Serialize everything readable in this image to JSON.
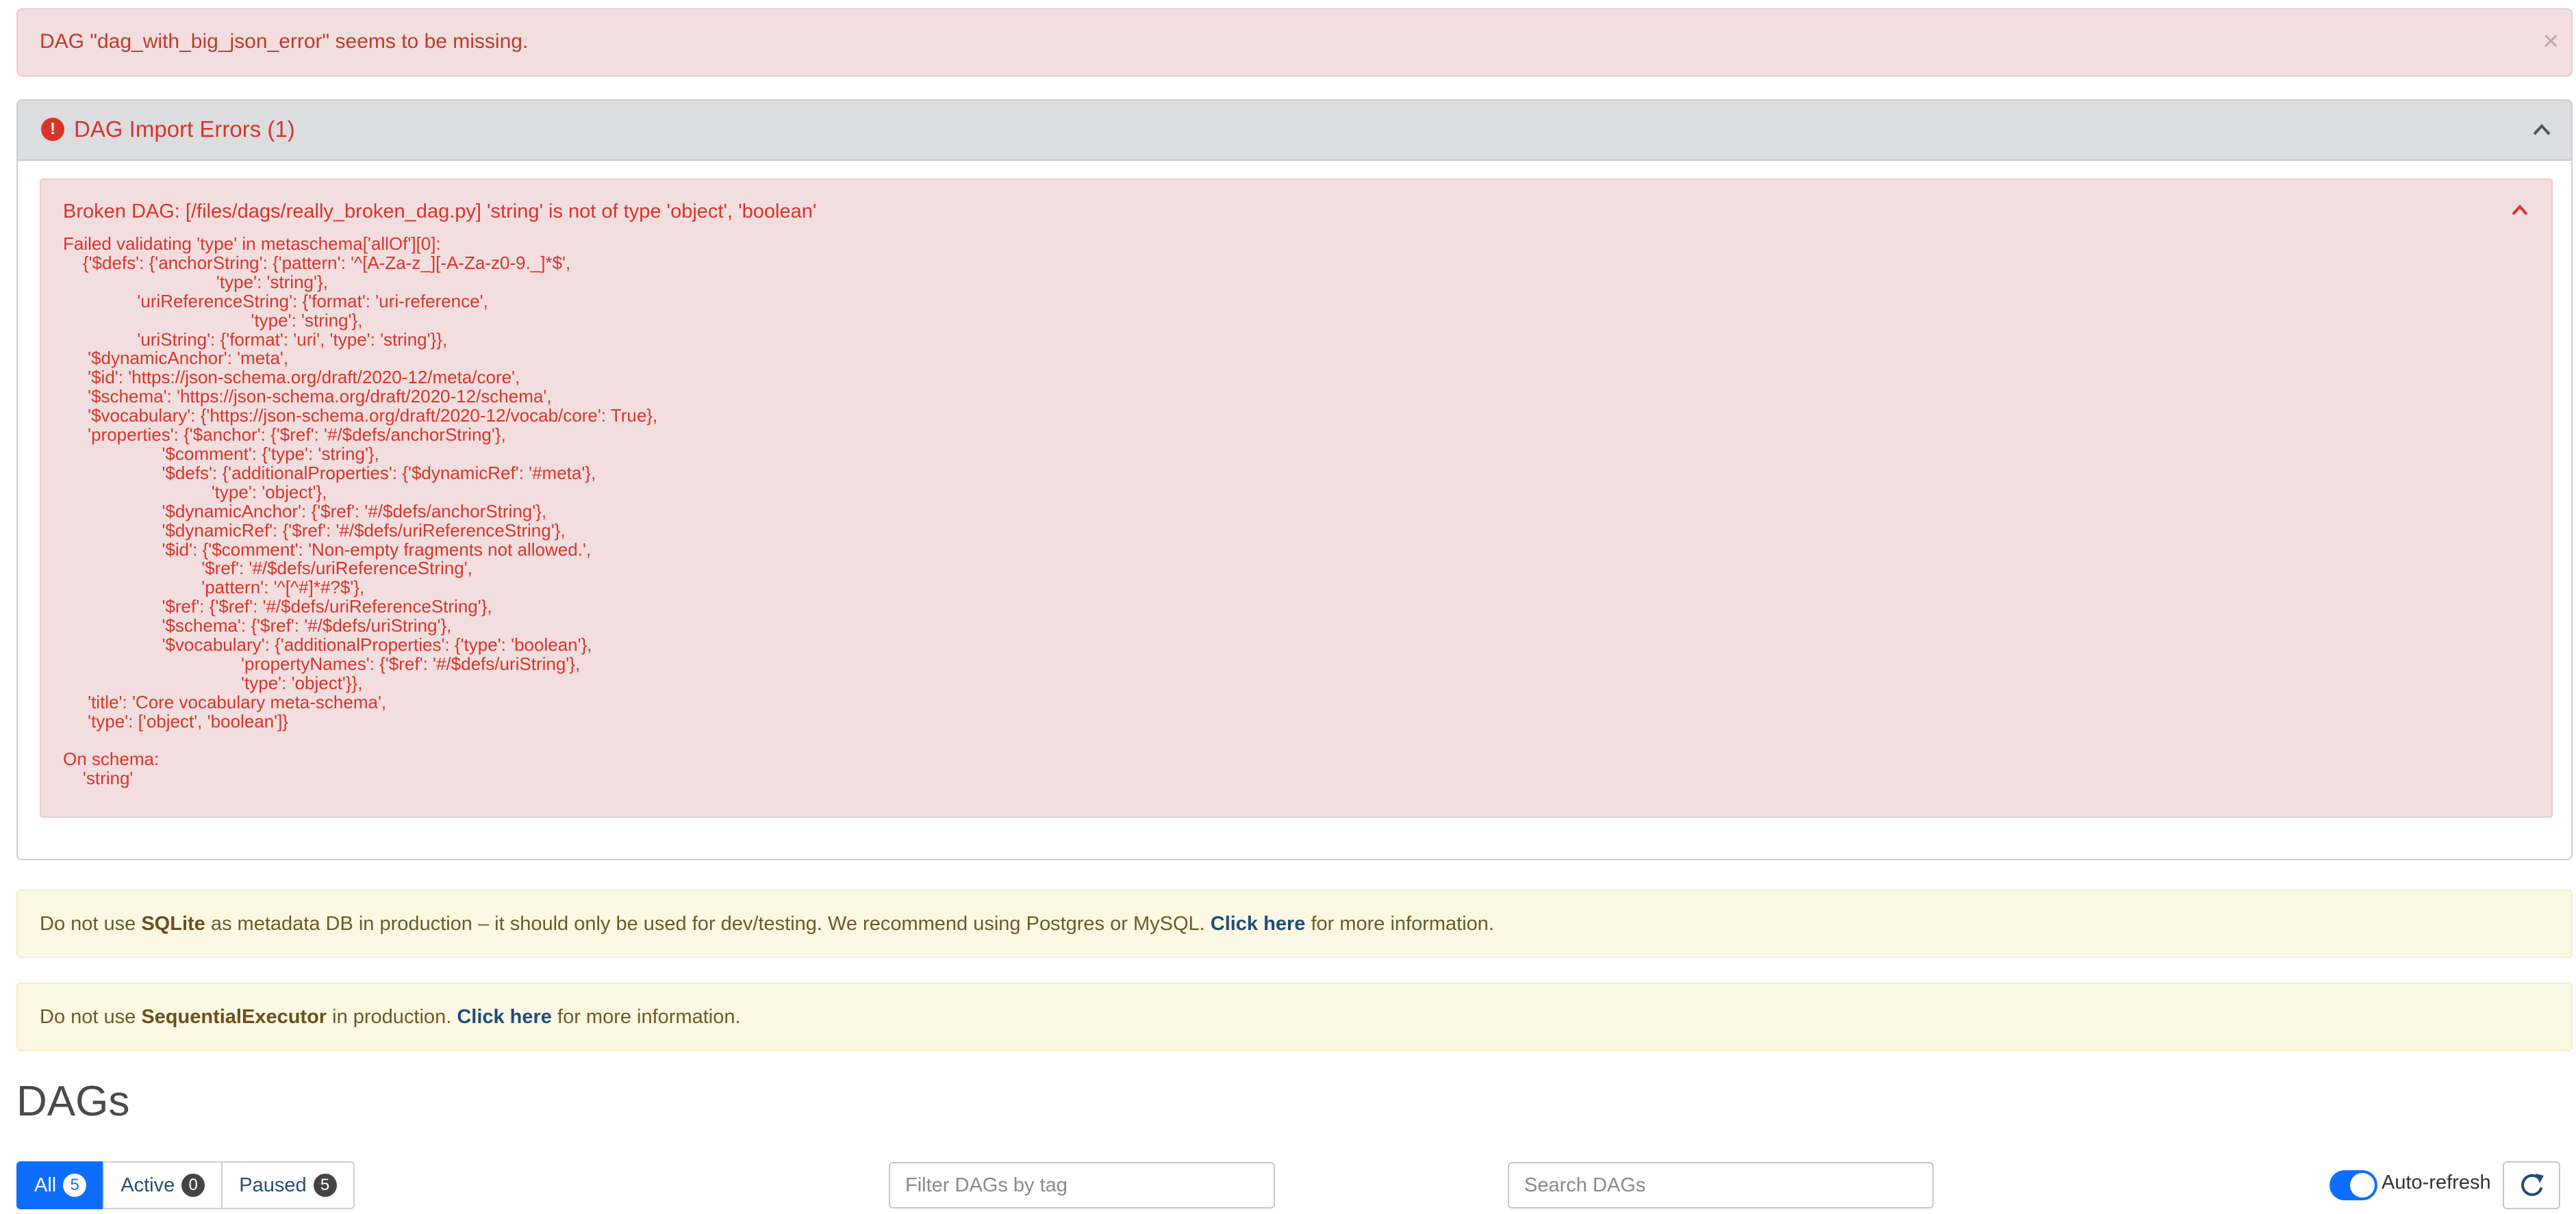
{
  "missing_alert": {
    "message": "DAG \"dag_with_big_json_error\" seems to be missing.",
    "close_glyph": "×"
  },
  "import_errors": {
    "title": "DAG Import Errors (1)",
    "icon_glyph": "!",
    "error": {
      "header": "Broken DAG: [/files/dags/really_broken_dag.py] 'string' is not of type 'object', 'boolean'",
      "details": "Failed validating 'type' in metaschema['allOf'][0]:\n    {'$defs': {'anchorString': {'pattern': '^[A-Za-z_][-A-Za-z0-9._]*$',\n                               'type': 'string'},\n               'uriReferenceString': {'format': 'uri-reference',\n                                      'type': 'string'},\n               'uriString': {'format': 'uri', 'type': 'string'}},\n     '$dynamicAnchor': 'meta',\n     '$id': 'https://json-schema.org/draft/2020-12/meta/core',\n     '$schema': 'https://json-schema.org/draft/2020-12/schema',\n     '$vocabulary': {'https://json-schema.org/draft/2020-12/vocab/core': True},\n     'properties': {'$anchor': {'$ref': '#/$defs/anchorString'},\n                    '$comment': {'type': 'string'},\n                    '$defs': {'additionalProperties': {'$dynamicRef': '#meta'},\n                              'type': 'object'},\n                    '$dynamicAnchor': {'$ref': '#/$defs/anchorString'},\n                    '$dynamicRef': {'$ref': '#/$defs/uriReferenceString'},\n                    '$id': {'$comment': 'Non-empty fragments not allowed.',\n                            '$ref': '#/$defs/uriReferenceString',\n                            'pattern': '^[^#]*#?$'},\n                    '$ref': {'$ref': '#/$defs/uriReferenceString'},\n                    '$schema': {'$ref': '#/$defs/uriString'},\n                    '$vocabulary': {'additionalProperties': {'type': 'boolean'},\n                                    'propertyNames': {'$ref': '#/$defs/uriString'},\n                                    'type': 'object'}},\n     'title': 'Core vocabulary meta-schema',\n     'type': ['object', 'boolean']}\n\nOn schema:\n    'string'"
    }
  },
  "warnings": {
    "sqlite": {
      "prefix": "Do not use ",
      "bold": "SQLite",
      "middle": " as metadata DB in production – it should only be used for dev/testing. We recommend using Postgres or MySQL. ",
      "link": "Click here",
      "suffix": " for more information."
    },
    "executor": {
      "prefix": "Do not use ",
      "bold": "SequentialExecutor",
      "middle": " in production. ",
      "link": "Click here",
      "suffix": " for more information."
    }
  },
  "dags": {
    "title": "DAGs",
    "filters": [
      {
        "label": "All",
        "count": "5"
      },
      {
        "label": "Active",
        "count": "0"
      },
      {
        "label": "Paused",
        "count": "5"
      }
    ],
    "tag_placeholder": "Filter DAGs by tag",
    "search_placeholder": "Search DAGs",
    "auto_refresh_label": "Auto-refresh"
  },
  "icons": {
    "close": "close-icon",
    "error": "error-circle-icon",
    "collapse": "chevron-up-icon",
    "refresh": "refresh-icon"
  },
  "colors": {
    "danger": "#d9342b",
    "primary": "#0d6efd",
    "warning_bg": "#fcf8e3",
    "danger_bg": "#f2dede"
  }
}
